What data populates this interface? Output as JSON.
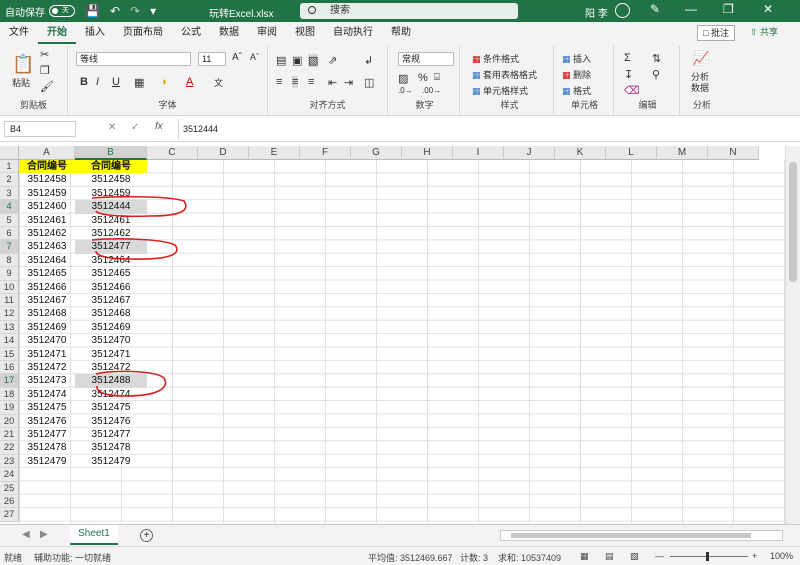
{
  "titlebar": {
    "autosave_label": "自动保存",
    "autosave_state": "关",
    "filename": "玩转Excel.xlsx",
    "search_placeholder": "搜索",
    "username": "阳 李"
  },
  "menu": {
    "items": [
      "文件",
      "开始",
      "插入",
      "页面布局",
      "公式",
      "数据",
      "审阅",
      "视图",
      "自动执行",
      "帮助"
    ],
    "active": "开始",
    "comment": "批注",
    "share": "共享"
  },
  "ribbon": {
    "clipboard": {
      "label": "剪贴板",
      "paste": "粘贴"
    },
    "font": {
      "label": "字体",
      "font_name": "等线",
      "font_size": "11",
      "bold": "B",
      "italic": "I",
      "underline": "U"
    },
    "alignment": {
      "label": "对齐方式"
    },
    "number": {
      "label": "数字",
      "format": "常规",
      "percent": "%"
    },
    "styles": {
      "label": "样式",
      "conditional": "条件格式",
      "table": "套用表格格式",
      "cell_styles": "单元格样式"
    },
    "cells": {
      "label": "单元格",
      "insert": "插入",
      "delete": "删除",
      "format": "格式"
    },
    "editing": {
      "label": "编辑"
    },
    "analysis": {
      "label": "分析",
      "analyze": "分析",
      "analyze2": "数据"
    }
  },
  "formula_bar": {
    "name_box": "B4",
    "fx": "fx",
    "value": "3512444"
  },
  "grid": {
    "columns": [
      "A",
      "B",
      "C",
      "D",
      "E",
      "F",
      "G",
      "H",
      "I",
      "J",
      "K",
      "L",
      "M",
      "N"
    ],
    "selected_column": "B",
    "rows": [
      "1",
      "2",
      "3",
      "4",
      "5",
      "6",
      "7",
      "8",
      "9",
      "10",
      "11",
      "12",
      "13",
      "14",
      "15",
      "16",
      "17",
      "18",
      "19",
      "20",
      "21",
      "22",
      "23",
      "24",
      "25",
      "26",
      "27"
    ],
    "selected_rows": [
      "4",
      "7",
      "17"
    ],
    "header_a": "合同编号",
    "header_b": "合同编号",
    "col_a": [
      "3512458",
      "3512459",
      "3512460",
      "3512461",
      "3512462",
      "3512463",
      "3512464",
      "3512465",
      "3512466",
      "3512467",
      "3512468",
      "3512469",
      "3512470",
      "3512471",
      "3512472",
      "3512473",
      "3512474",
      "3512475",
      "3512476",
      "3512477",
      "3512478",
      "3512479"
    ],
    "col_b": [
      "3512458",
      "3512459",
      "3512444",
      "3512461",
      "3512462",
      "3512477",
      "3512464",
      "3512465",
      "3512466",
      "3512467",
      "3512468",
      "3512469",
      "3512470",
      "3512471",
      "3512472",
      "3512488",
      "3512474",
      "3512475",
      "3512476",
      "3512477",
      "3512478",
      "3512479"
    ]
  },
  "sheets": {
    "tabs": [
      "Sheet1"
    ],
    "add": "+"
  },
  "status": {
    "ready": "就绪",
    "accessibility": "辅助功能: 一切就绪",
    "average": "平均值: 3512469.667",
    "count": "计数: 3",
    "sum": "求和: 10537409",
    "zoom": "100%"
  },
  "colors": {
    "excel_green": "#217346",
    "header_fill": "#ffff00",
    "annotation": "#d62020"
  }
}
